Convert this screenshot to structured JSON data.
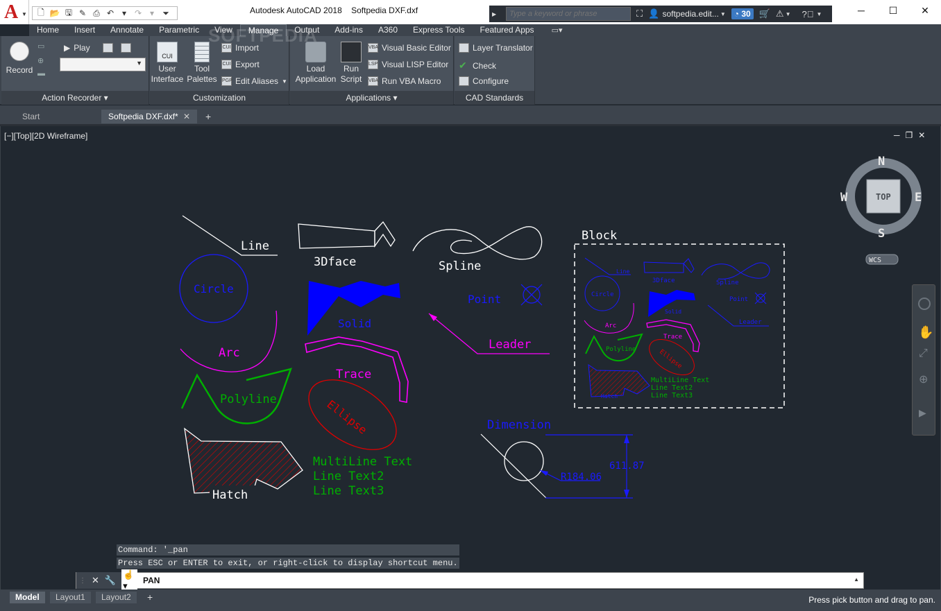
{
  "app": {
    "title": "Autodesk AutoCAD 2018",
    "file": "Softpedia DXF.dxf",
    "watermark": "SOFTPEDIA"
  },
  "search": {
    "placeholder": "Type a keyword or phrase",
    "user": "softpedia.edit...",
    "clock_count": "30"
  },
  "ribbon_tabs": [
    "Home",
    "Insert",
    "Annotate",
    "Parametric",
    "View",
    "Manage",
    "Output",
    "Add-ins",
    "A360",
    "Express Tools",
    "Featured Apps"
  ],
  "active_tab": "Manage",
  "panels": {
    "action_recorder": {
      "title": "Action Recorder",
      "record": "Record",
      "play": "Play"
    },
    "customization": {
      "title": "Customization",
      "user_interface": "User Interface",
      "tool_palettes": "Tool Palettes",
      "import": "Import",
      "export": "Export",
      "edit_aliases": "Edit Aliases",
      "cui": "CUI"
    },
    "applications": {
      "title": "Applications",
      "load_application": "Load Application",
      "run_script": "Run Script",
      "vba_editor": "Visual Basic Editor",
      "lisp_editor": "Visual LISP Editor",
      "run_vba": "Run VBA Macro"
    },
    "cad_standards": {
      "title": "CAD Standards",
      "layer_translator": "Layer Translator",
      "check": "Check",
      "configure": "Configure"
    }
  },
  "doc_tabs": {
    "start": "Start",
    "file": "Softpedia DXF.dxf*"
  },
  "viewport": {
    "label": "[−][Top][2D Wireframe]"
  },
  "viewcube": {
    "n": "N",
    "s": "S",
    "e": "E",
    "w": "W",
    "top": "TOP",
    "wcs": "WCS"
  },
  "drawing": {
    "line": "Line",
    "face": "3Dface",
    "spline": "Spline",
    "block": "Block",
    "circle": "Circle",
    "solid": "Solid",
    "point": "Point",
    "leader": "Leader",
    "arc": "Arc",
    "trace": "Trace",
    "polyline": "Polyline",
    "ellipse": "Ellipse",
    "dimension": "Dimension",
    "hatch": "Hatch",
    "mtext1": "MultiLine Text",
    "mtext2": "Line Text2",
    "mtext3": "Line Text3",
    "dim_v": "611.87",
    "dim_r": "R184.06"
  },
  "command": {
    "history1": "Command: '_pan",
    "history2": "Press ESC or ENTER to exit, or right-click to display shortcut menu.",
    "current": "PAN"
  },
  "layouts": [
    "Model",
    "Layout1",
    "Layout2"
  ],
  "status": "Press pick button and drag to pan.",
  "colors": {
    "background": "#212830",
    "blue": "#0000ff",
    "magenta": "#ff00ff",
    "green": "#00a000",
    "red": "#e00000",
    "white": "#ffffff"
  }
}
